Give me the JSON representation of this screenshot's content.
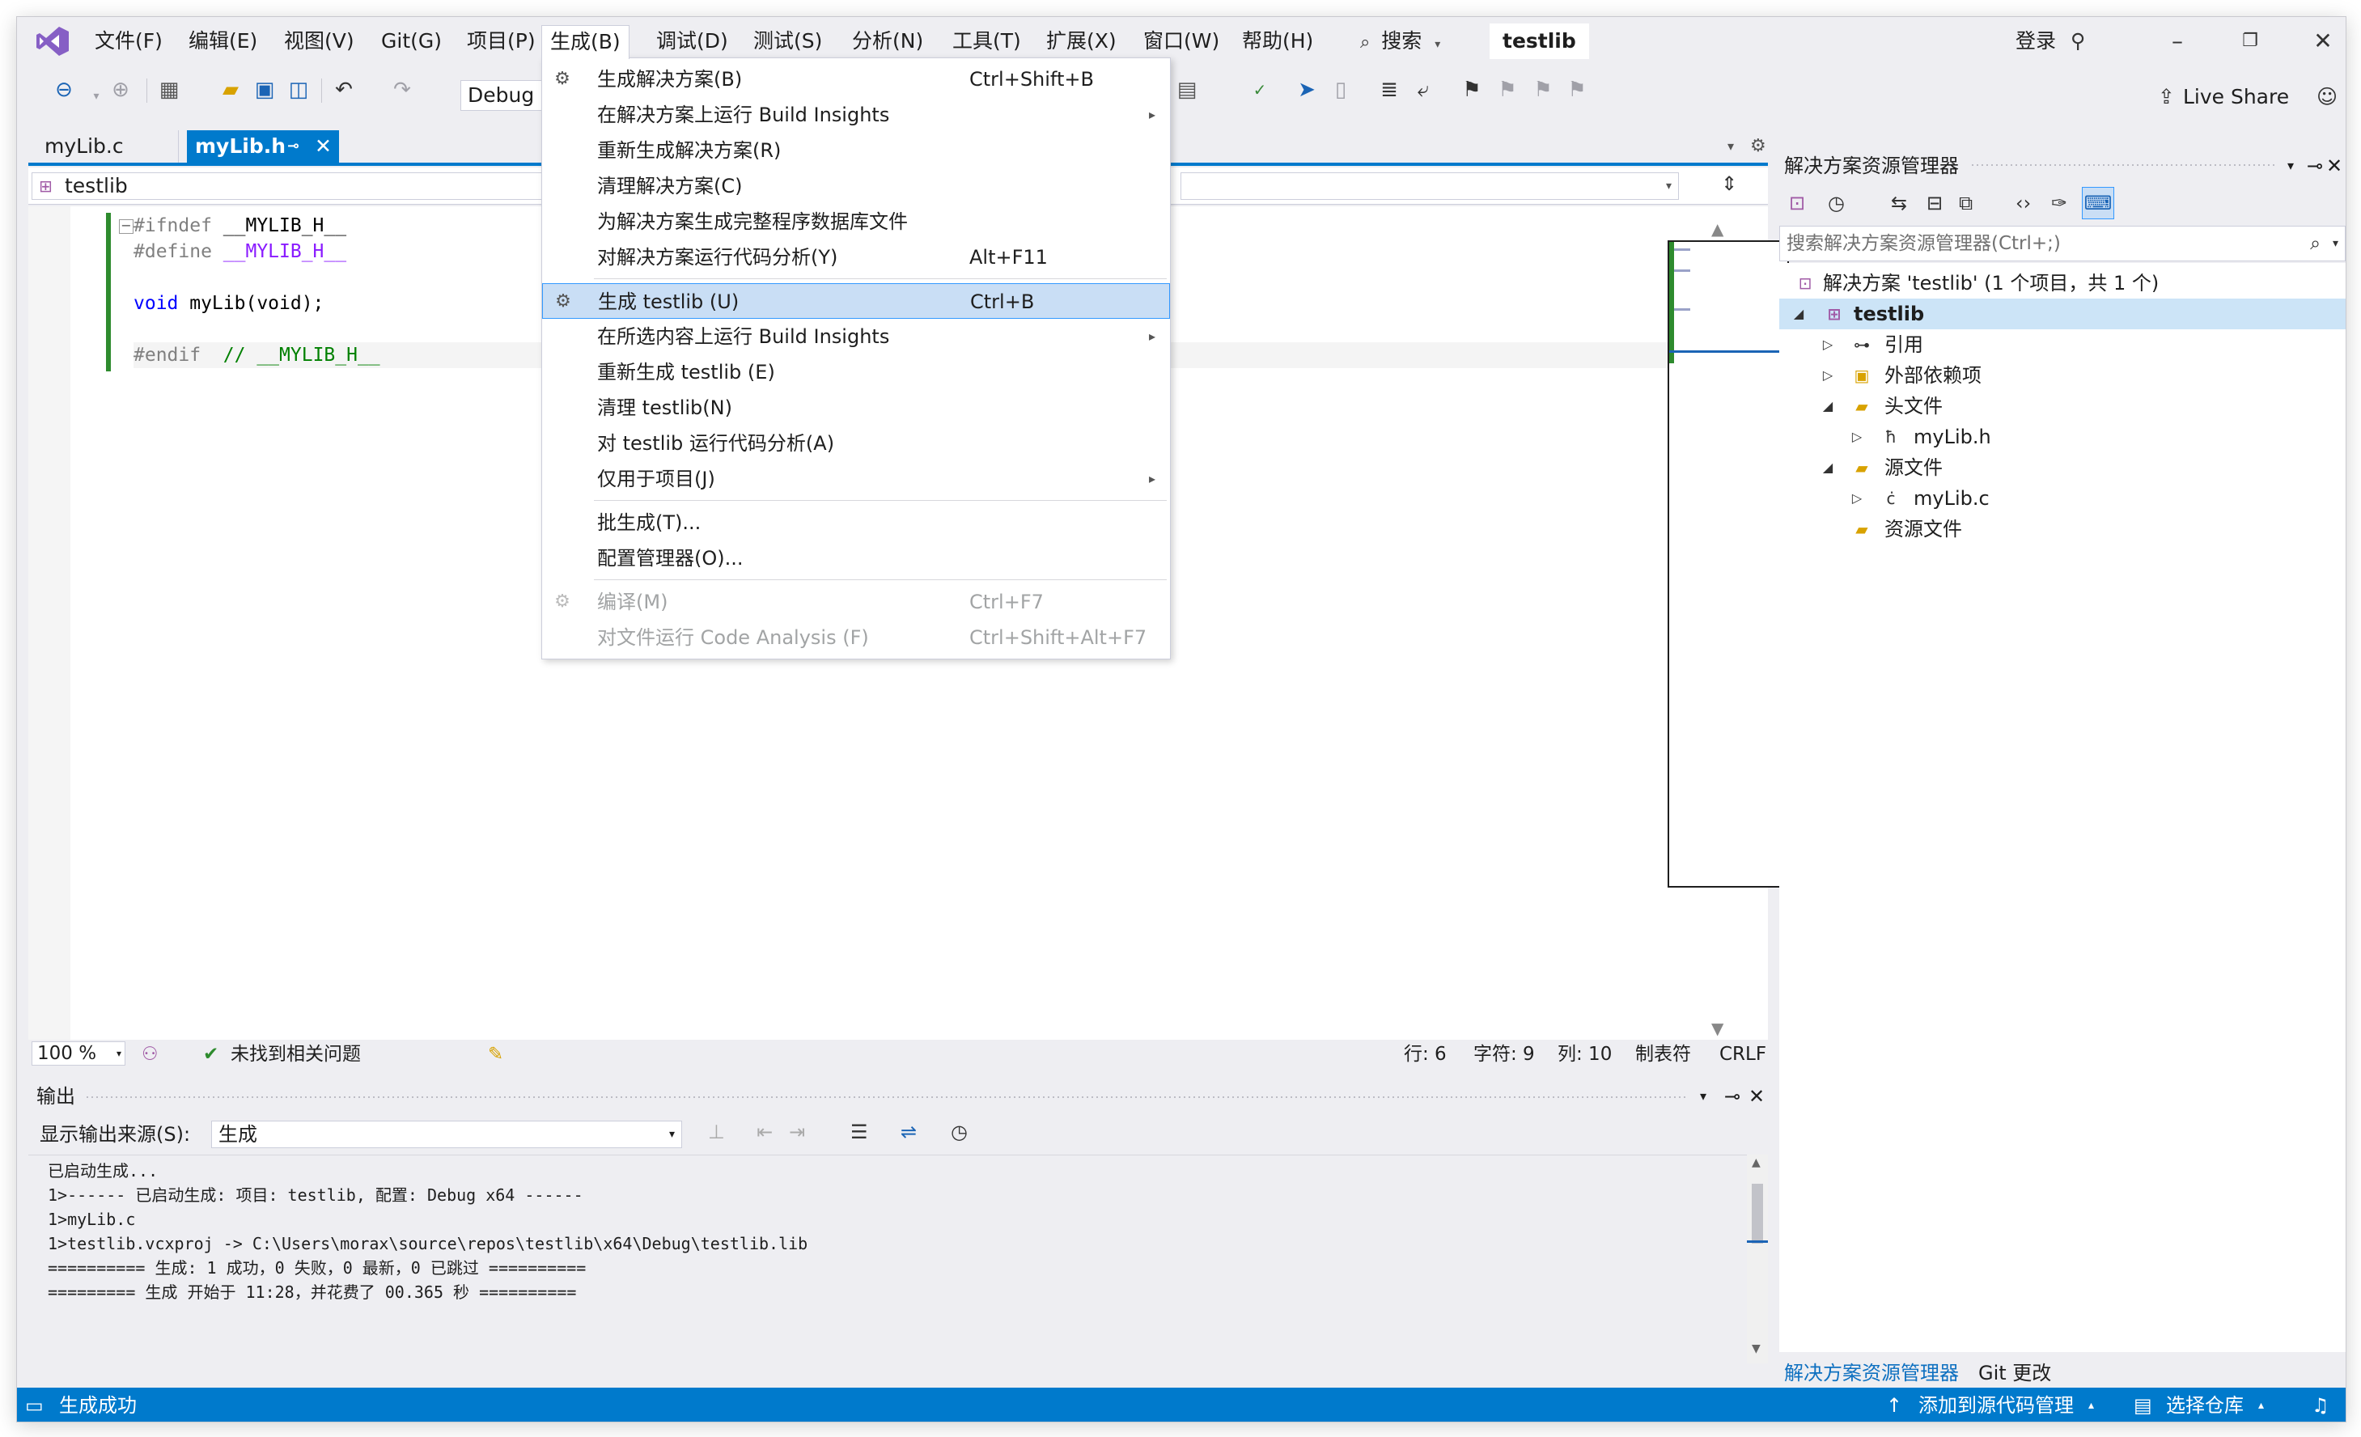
{
  "menu": {
    "items": [
      "文件(F)",
      "编辑(E)",
      "视图(V)",
      "Git(G)",
      "项目(P)",
      "生成(B)",
      "调试(D)",
      "测试(S)",
      "分析(N)",
      "工具(T)",
      "扩展(X)",
      "窗口(W)",
      "帮助(H)"
    ],
    "search": "搜索",
    "solution_name": "testlib",
    "login": "登录"
  },
  "toolbar": {
    "config": "Debug",
    "live_share": "Live Share"
  },
  "doc_tabs": [
    {
      "label": "myLib.c"
    },
    {
      "label": "myLib.h"
    }
  ],
  "nav_bar": {
    "project": "testlib"
  },
  "code": {
    "lines": [
      {
        "a": "#ifndef",
        "b": " __MYLIB_H__"
      },
      {
        "a": "#define",
        "b": " __MYLIB_H__"
      },
      {
        "a": "void",
        "b": " myLib(void);"
      },
      {
        "a": "#endif",
        "b": "  // __MYLIB_H__"
      }
    ]
  },
  "build_menu": {
    "items": [
      {
        "label": "生成解决方案(B)",
        "shortcut": "Ctrl+Shift+B"
      },
      {
        "label": "在解决方案上运行 Build Insights",
        "shortcut": ""
      },
      {
        "label": "重新生成解决方案(R)",
        "shortcut": ""
      },
      {
        "label": "清理解决方案(C)",
        "shortcut": ""
      },
      {
        "label": "为解决方案生成完整程序数据库文件",
        "shortcut": ""
      },
      {
        "label": "对解决方案运行代码分析(Y)",
        "shortcut": "Alt+F11"
      },
      {
        "label": "生成 testlib (U)",
        "shortcut": "Ctrl+B"
      },
      {
        "label": "在所选内容上运行 Build Insights",
        "shortcut": ""
      },
      {
        "label": "重新生成 testlib (E)",
        "shortcut": ""
      },
      {
        "label": "清理 testlib(N)",
        "shortcut": ""
      },
      {
        "label": "对 testlib 运行代码分析(A)",
        "shortcut": ""
      },
      {
        "label": "仅用于项目(J)",
        "shortcut": ""
      },
      {
        "label": "批生成(T)...",
        "shortcut": ""
      },
      {
        "label": "配置管理器(O)...",
        "shortcut": ""
      },
      {
        "label": "编译(M)",
        "shortcut": "Ctrl+F7"
      },
      {
        "label": "对文件运行 Code Analysis (F)",
        "shortcut": "Ctrl+Shift+Alt+F7"
      }
    ]
  },
  "editor_status": {
    "zoom": "100 %",
    "issues": "未找到相关问题",
    "line": "行: 6",
    "char": "字符: 9",
    "col": "列: 10",
    "tabs": "制表符",
    "eol": "CRLF"
  },
  "output": {
    "title": "输出",
    "source_label": "显示输出来源(S):",
    "source_value": "生成",
    "lines": [
      "已启动生成...",
      "1>------ 已启动生成: 项目: testlib, 配置: Debug x64 ------",
      "1>myLib.c",
      "1>testlib.vcxproj -> C:\\Users\\morax\\source\\repos\\testlib\\x64\\Debug\\testlib.lib",
      "========== 生成: 1 成功，0 失败，0 最新，0 已跳过 ==========",
      "========= 生成 开始于 11:28，并花费了 00.365 秒 =========="
    ]
  },
  "solution_explorer": {
    "title": "解决方案资源管理器",
    "search_placeholder": "搜索解决方案资源管理器(Ctrl+;)",
    "tree": [
      {
        "label": "解决方案 'testlib' (1 个项目，共 1 个)"
      },
      {
        "label": "testlib"
      },
      {
        "label": "引用"
      },
      {
        "label": "外部依赖项"
      },
      {
        "label": "头文件"
      },
      {
        "label": "myLib.h"
      },
      {
        "label": "源文件"
      },
      {
        "label": "myLib.c"
      },
      {
        "label": "资源文件"
      }
    ],
    "tabs": [
      "解决方案资源管理器",
      "Git 更改"
    ]
  },
  "statusbar": {
    "message": "生成成功",
    "add_source": "添加到源代码管理",
    "select_repo": "选择仓库"
  },
  "colors": {
    "accent": "#007acc",
    "highlight": "#c9def5",
    "menu_bg": "#eeeef2"
  }
}
